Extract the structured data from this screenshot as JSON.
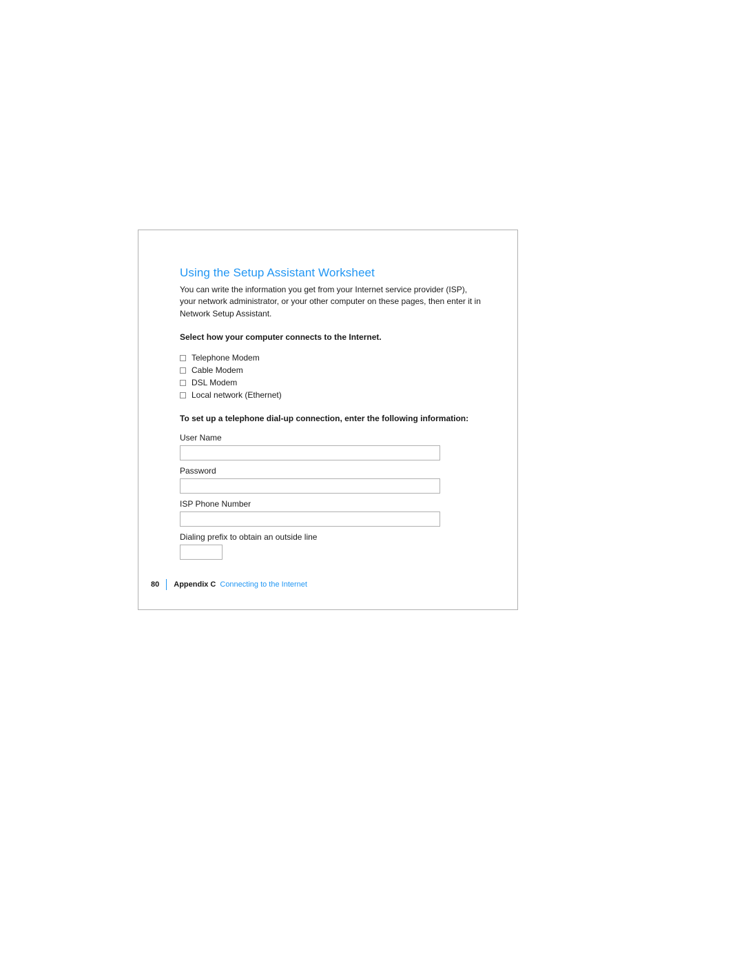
{
  "title": "Using the Setup Assistant Worksheet",
  "intro": "You can write the information you get from your Internet service provider (ISP), your network administrator, or your other computer on these pages, then enter it in Network Setup Assistant.",
  "select_heading": "Select how your computer connects to the Internet.",
  "options": [
    "Telephone Modem",
    "Cable Modem",
    "DSL Modem",
    "Local network (Ethernet)"
  ],
  "dialup_heading": "To set up a telephone dial-up connection, enter the following information:",
  "fields": {
    "user_name": {
      "label": "User Name",
      "value": ""
    },
    "password": {
      "label": "Password",
      "value": ""
    },
    "isp_phone": {
      "label": "ISP Phone Number",
      "value": ""
    },
    "dialing_prefix": {
      "label": "Dialing prefix to obtain an outside line",
      "value": ""
    }
  },
  "footer": {
    "page_number": "80",
    "appendix": "Appendix C",
    "chapter": "Connecting to the Internet"
  }
}
